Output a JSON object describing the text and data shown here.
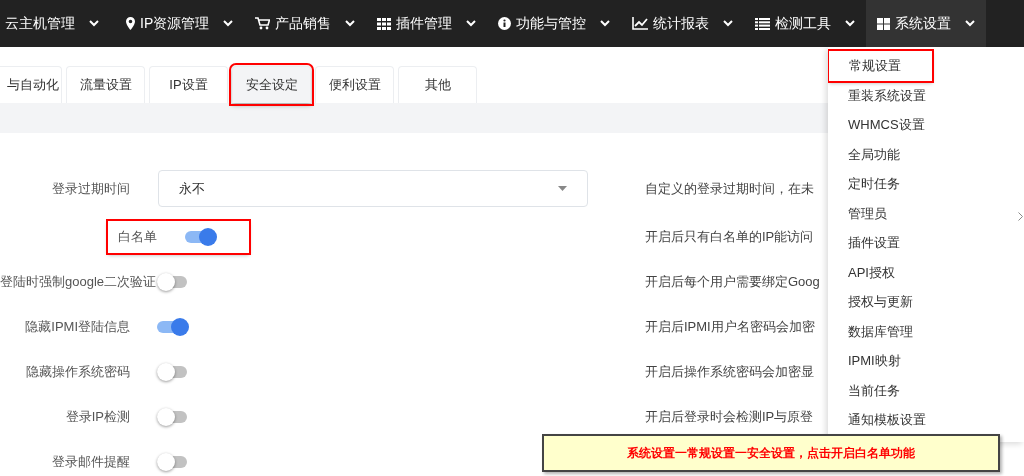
{
  "nav": [
    {
      "label": "云主机管理",
      "selected": false
    },
    {
      "label": "IP资源管理",
      "selected": false
    },
    {
      "label": "产品销售",
      "selected": false
    },
    {
      "label": "插件管理",
      "selected": false
    },
    {
      "label": "功能与管控",
      "selected": false
    },
    {
      "label": "统计报表",
      "selected": false
    },
    {
      "label": "检测工具",
      "selected": false
    },
    {
      "label": "系统设置",
      "selected": true
    }
  ],
  "tabs": [
    {
      "label": "与自动化",
      "selected": false,
      "highlighted": false
    },
    {
      "label": "流量设置",
      "selected": false,
      "highlighted": false
    },
    {
      "label": "IP设置",
      "selected": false,
      "highlighted": false
    },
    {
      "label": "安全设定",
      "selected": true,
      "highlighted": true
    },
    {
      "label": "便利设置",
      "selected": false,
      "highlighted": false
    },
    {
      "label": "其他",
      "selected": false,
      "highlighted": false
    }
  ],
  "settings": [
    {
      "kind": "select",
      "label": "登录过期时间",
      "value": "永不",
      "description": "自定义的登录过期时间，在未",
      "highlighted": false
    },
    {
      "kind": "switch",
      "label": "白名单",
      "on": true,
      "description": "开启后只有白名单的IP能访问",
      "highlighted": true
    },
    {
      "kind": "switch",
      "label": "登陆时强制google二次验证",
      "on": false,
      "description": "开启后每个用户需要绑定Goog",
      "highlighted": false
    },
    {
      "kind": "switch",
      "label": "隐藏IPMI登陆信息",
      "on": true,
      "description": "开启后IPMI用户名密码会加密",
      "highlighted": false
    },
    {
      "kind": "switch",
      "label": "隐藏操作系统密码",
      "on": false,
      "description": "开启后操作系统密码会加密显",
      "highlighted": false
    },
    {
      "kind": "switch",
      "label": "登录IP检测",
      "on": false,
      "description": "开启后登录时会检测IP与原登",
      "highlighted": false
    },
    {
      "kind": "switch",
      "label": "登录邮件提醒",
      "on": false,
      "highlighted": false
    }
  ],
  "dropdown": [
    {
      "label": "常规设置",
      "highlighted": true
    },
    {
      "label": "重装系统设置",
      "highlighted": false
    },
    {
      "label": "WHMCS设置",
      "highlighted": false
    },
    {
      "label": "全局功能",
      "highlighted": false
    },
    {
      "label": "定时任务",
      "highlighted": false
    },
    {
      "label": "管理员",
      "highlighted": false
    },
    {
      "label": "插件设置",
      "highlighted": false
    },
    {
      "label": "API授权",
      "highlighted": false
    },
    {
      "label": "授权与更新",
      "highlighted": false
    },
    {
      "label": "数据库管理",
      "highlighted": false
    },
    {
      "label": "IPMI映射",
      "highlighted": false
    },
    {
      "label": "当前任务",
      "highlighted": false
    },
    {
      "label": "通知模板设置",
      "highlighted": false
    }
  ],
  "note": "系统设置一常规设置一安全设置，点击开启白名单功能"
}
